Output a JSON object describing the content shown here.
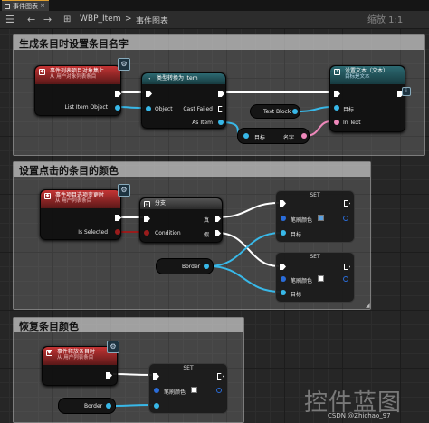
{
  "tab": {
    "label": "事件图表",
    "close": "×"
  },
  "toolbar": {
    "back": "←",
    "forward": "→",
    "class_name": "WBP_Item",
    "sep": ">",
    "graph_name": "事件图表",
    "overlay": "缩放 1:1"
  },
  "comments": [
    {
      "title": "生成条目时设置条目名字"
    },
    {
      "title": "设置点击的条目的颜色"
    },
    {
      "title": "恢复条目颜色"
    }
  ],
  "nodes": {
    "ev_added": {
      "title": "事件列表项目对象集上",
      "subtitle": "从 用户对象列表条目",
      "pin": "List Item Object"
    },
    "cast": {
      "title": "类型转换为 Item",
      "pin_object": "Object",
      "pin_failed": "Cast Failed",
      "pin_as": "As Item"
    },
    "settext": {
      "title": "设置文本（文本）",
      "subtitle": "目标是文本",
      "pin_target": "目标",
      "pin_text": "In Text"
    },
    "textblock": {
      "label": "Text Block"
    },
    "getname": {
      "target": "目标",
      "name": "名字"
    },
    "ev_selected": {
      "title": "事件项目选项变更时",
      "subtitle": "从 用户列表条目",
      "pin": "Is Selected"
    },
    "branch": {
      "title": "分支",
      "pin_cond": "Condition",
      "pin_true": "真",
      "pin_false": "假"
    },
    "set1": {
      "title": "SET",
      "pin_color": "笔刷颜色",
      "pin_target": "目标",
      "swatch": "#5aa0e0"
    },
    "set2": {
      "title": "SET",
      "pin_color": "笔刷颜色",
      "pin_target": "目标",
      "swatch": "#ffffff"
    },
    "border1": {
      "label": "Border"
    },
    "ev_released": {
      "title": "事件释放条目时",
      "subtitle": "从 用户列表条目"
    },
    "set3": {
      "title": "SET",
      "pin_color": "笔刷颜色",
      "pin_target": "目标",
      "swatch": "#ffffff"
    },
    "border2": {
      "label": "Border"
    }
  },
  "watermark": "控件蓝图",
  "credit": "CSDN @Zhichao_97",
  "colors": {
    "exec": "#ffffff",
    "object": "#38b8e8",
    "text": "#ee88bb",
    "bool": "#9a1c1c",
    "struct": "#2a6cd8"
  }
}
